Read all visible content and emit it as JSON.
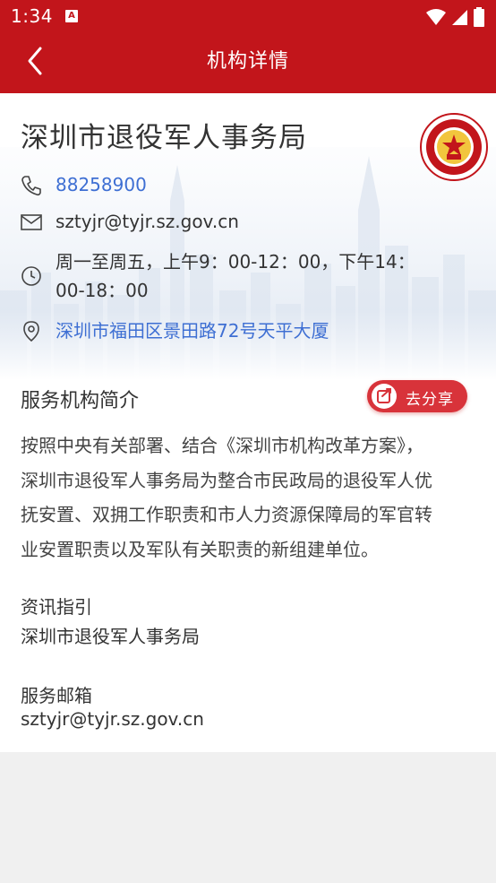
{
  "status_bar": {
    "time": "1:34",
    "notification_icon": "A",
    "icons": [
      "wifi-icon",
      "signal-icon",
      "battery-icon"
    ]
  },
  "app_bar": {
    "title": "机构详情",
    "back_icon": "chevron-left-icon"
  },
  "org": {
    "name": "深圳市退役军人事务局",
    "logo_icon": "veterans-bureau-emblem",
    "logo_text": "深圳市退役军人事务局"
  },
  "contact": {
    "phone": "88258900",
    "email": "sztyjr@tyjr.sz.gov.cn",
    "hours_line1": "周一至周五，上午9：00-12：00，下午14：",
    "hours_line2": "00-18：00",
    "address": "深圳市福田区景田路72号天平大厦"
  },
  "intro": {
    "title": "服务机构简介",
    "share_label": "去分享",
    "paragraph_lines": [
      "按照中央有关部署、结合《深圳市机构改革方案》，",
      "深圳市退役军人事务局为整合市民政局的退役军人优",
      "抚安置、双拥工作职责和市人力资源保障局的军官转",
      "业安置职责以及军队有关职责的新组建单位。"
    ]
  },
  "info_guide": {
    "label": "资讯指引",
    "value": "深圳市退役军人事务局"
  },
  "service_email": {
    "label": "服务邮箱",
    "value": "sztyjr@tyjr.sz.gov.cn"
  },
  "colors": {
    "brand_red": "#c2151b",
    "link_blue": "#3e6fd3",
    "share_red": "#d8333a",
    "background": "#f0f0f0"
  }
}
